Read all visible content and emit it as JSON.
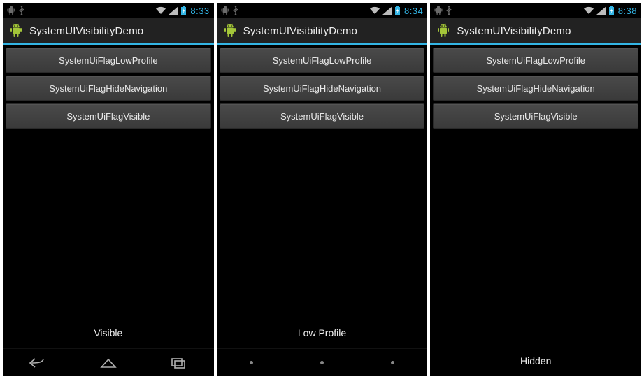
{
  "screens": [
    {
      "status": {
        "time": "8:33",
        "icons": [
          "bugdroid-dim",
          "usb-dim",
          "wifi",
          "signal",
          "battery-charging"
        ]
      },
      "actionbar": {
        "title": "SystemUIVisibilityDemo",
        "icon": "bugdroid"
      },
      "buttons": [
        "SystemUiFlagLowProfile",
        "SystemUiFlagHideNavigation",
        "SystemUiFlagVisible"
      ],
      "status_text": "Visible",
      "nav": {
        "mode": "visible",
        "buttons": [
          "back",
          "home",
          "recents"
        ]
      }
    },
    {
      "status": {
        "time": "8:34",
        "icons": [
          "bugdroid-dim",
          "usb-dim",
          "wifi",
          "signal",
          "battery-charging"
        ]
      },
      "actionbar": {
        "title": "SystemUIVisibilityDemo",
        "icon": "bugdroid"
      },
      "buttons": [
        "SystemUiFlagLowProfile",
        "SystemUiFlagHideNavigation",
        "SystemUiFlagVisible"
      ],
      "status_text": "Low Profile",
      "nav": {
        "mode": "low_profile",
        "buttons": [
          "back",
          "home",
          "recents"
        ]
      }
    },
    {
      "status": {
        "time": "8:38",
        "icons": [
          "bugdroid-dim",
          "usb-dim",
          "wifi",
          "signal",
          "battery-charging"
        ]
      },
      "actionbar": {
        "title": "SystemUIVisibilityDemo",
        "icon": "bugdroid"
      },
      "buttons": [
        "SystemUiFlagLowProfile",
        "SystemUiFlagHideNavigation",
        "SystemUiFlagVisible"
      ],
      "status_text": "Hidden",
      "nav": {
        "mode": "hidden",
        "buttons": []
      }
    }
  ],
  "colors": {
    "accent": "#33b5e5",
    "android_green": "#a4c639"
  }
}
